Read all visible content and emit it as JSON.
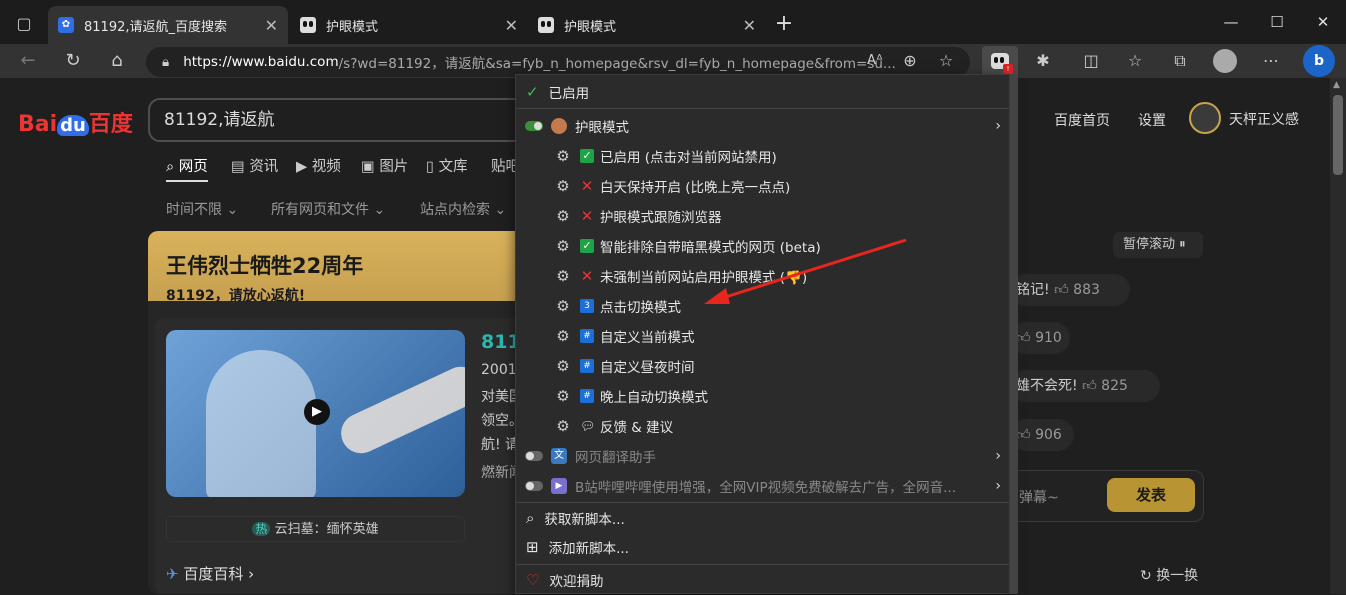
{
  "tabs": [
    {
      "title": "81192,请返航_百度搜索",
      "active": true
    },
    {
      "title": "护眼模式",
      "active": false
    },
    {
      "title": "护眼模式",
      "active": false
    }
  ],
  "address": {
    "host": "https://www.baidu.com",
    "rest": "/s?wd=81192，请返航&sa=fyb_n_homepage&rsv_dl=fyb_n_homepage&from=su..."
  },
  "baidu": {
    "logo_bai": "Bai",
    "logo_du": "du",
    "logo_cn": "百度",
    "query": "81192,请返航",
    "nav_tabs": [
      "网页",
      "资讯",
      "视频",
      "图片",
      "文库",
      "贴吧"
    ],
    "filters": [
      "时间不限",
      "所有网页和文件",
      "站点内检索"
    ],
    "top_links": [
      "百度首页",
      "设置"
    ],
    "username": "天枰正义感",
    "card_title": "王伟烈士牺牲22周年",
    "card_subtitle": "81192，请放心返航!",
    "card_link": "811",
    "card_text": [
      "2001-",
      "对美国",
      "领空。",
      "航! 请",
      "燃新闻"
    ],
    "hot_label": "热",
    "hot_text": "云扫墓：缅怀英雄",
    "encyclopedia": "百度百科",
    "pause": "暂停滚动",
    "danmaku": [
      {
        "text": "铭记!",
        "likes": "883"
      },
      {
        "text": "",
        "likes": "910"
      },
      {
        "text": "雄不会死!",
        "likes": "825"
      },
      {
        "text": "",
        "likes": "906"
      }
    ],
    "danmaku_placeholder": "弹幕~",
    "send": "发表",
    "refresh": "换一换"
  },
  "menu": {
    "enabled": "已启用",
    "eye_mode": "护眼模式",
    "items": [
      {
        "mark": "check",
        "label": "已启用 (点击对当前网站禁用)"
      },
      {
        "mark": "x",
        "label": "白天保持开启 (比晚上亮一点点)"
      },
      {
        "mark": "x",
        "label": "护眼模式跟随浏览器"
      },
      {
        "mark": "check",
        "label": "智能排除自带暗黑模式的网页 (beta)"
      },
      {
        "mark": "x",
        "label": "未强制当前网站启用护眼模式 (👎)"
      },
      {
        "mark": "3",
        "label": "点击切换模式"
      },
      {
        "mark": "#",
        "label": "自定义当前模式"
      },
      {
        "mark": "#",
        "label": "自定义昼夜时间"
      },
      {
        "mark": "#",
        "label": "晚上自动切换模式"
      },
      {
        "mark": "chat",
        "label": "反馈 & 建议"
      }
    ],
    "translate": "网页翻译助手",
    "bilibili": "B站哔哩哔哩使用增强，全网VIP视频免费破解去广告，全网音...",
    "get_scripts": "获取新脚本...",
    "add_script": "添加新脚本...",
    "donate": "欢迎捐助"
  },
  "colors": {
    "accent_red": "#e03636",
    "check_green": "#1ea446",
    "card_gold": "#d9b25a"
  }
}
